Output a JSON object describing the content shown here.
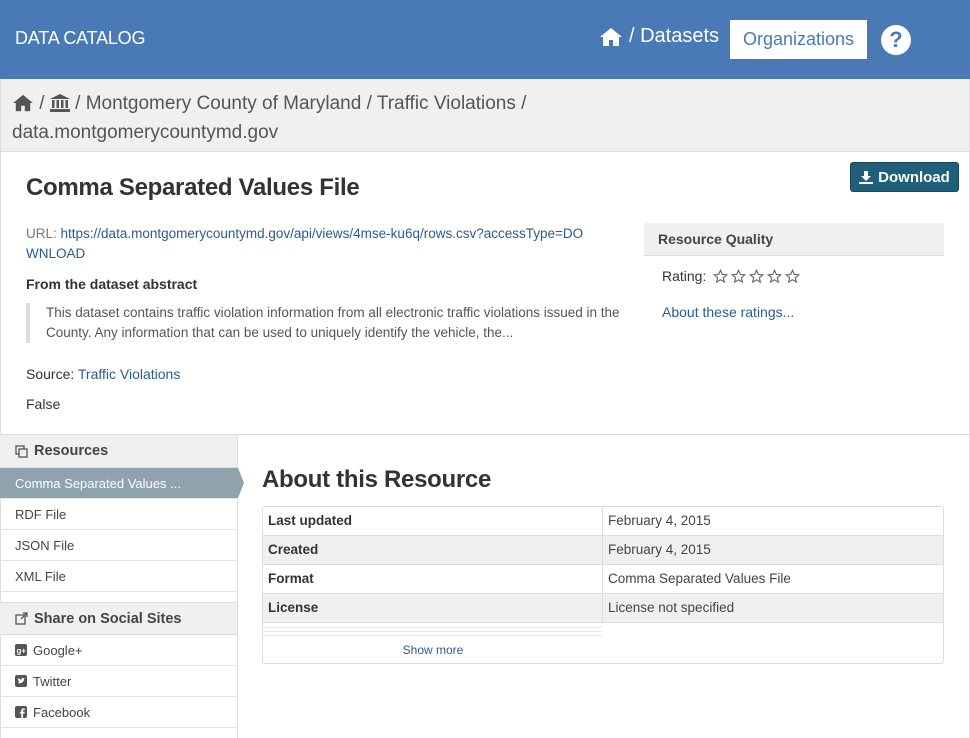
{
  "header": {
    "brand": "DATA CATALOG",
    "nav_datasets": "/ Datasets",
    "nav_organizations": "Organizations",
    "help_glyph": "?",
    "colors": {
      "bar": "#4a7ab5"
    }
  },
  "breadcrumb": {
    "sep": "/",
    "organization": "Montgomery County of Maryland",
    "dataset": "Traffic Violations",
    "resource": "data.montgomerycountymd.gov"
  },
  "resource": {
    "title": "Comma Separated Values File",
    "download_label": "Download",
    "url_label": "URL:",
    "url": "https://data.montgomerycountymd.gov/api/views/4mse-ku6q/rows.csv?accessType=DOWNLOAD",
    "abstract_heading": "From the dataset abstract",
    "abstract": "This dataset contains traffic violation information from all electronic traffic violations issued in the County. Any information that can be used to uniquely identify the vehicle, the...",
    "source_label": "Source:",
    "source_link": "Traffic Violations",
    "flag_text": "False"
  },
  "quality": {
    "heading": "Resource Quality",
    "rating_label": "Rating:",
    "rating_stars_filled": 0,
    "rating_stars_total": 5,
    "about_link": "About these ratings..."
  },
  "sidebar": {
    "resources_heading": "Resources",
    "resources": [
      {
        "label": "Comma Separated Values ...",
        "active": true
      },
      {
        "label": "RDF File",
        "active": false
      },
      {
        "label": "JSON File",
        "active": false
      },
      {
        "label": "XML File",
        "active": false
      }
    ],
    "share_heading": "Share on Social Sites",
    "share": [
      {
        "label": "Google+",
        "icon": "google-plus-icon"
      },
      {
        "label": "Twitter",
        "icon": "twitter-icon"
      },
      {
        "label": "Facebook",
        "icon": "facebook-icon"
      }
    ]
  },
  "about": {
    "heading": "About this Resource",
    "rows": [
      {
        "key": "Last updated",
        "value": "February 4, 2015"
      },
      {
        "key": "Created",
        "value": "February 4, 2015"
      },
      {
        "key": "Format",
        "value": "Comma Separated Values File"
      },
      {
        "key": "License",
        "value": "License not specified"
      }
    ],
    "show_more": "Show more"
  }
}
